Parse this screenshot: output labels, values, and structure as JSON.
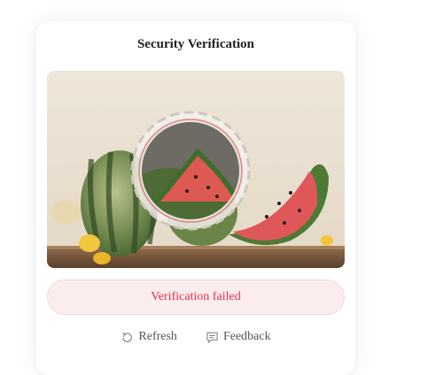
{
  "dialog": {
    "title": "Security Verification",
    "status_message": "Verification failed"
  },
  "captcha": {
    "image_subject": "watermelon",
    "rotate_piece": "circular-rotate-piece"
  },
  "actions": {
    "refresh_label": "Refresh",
    "feedback_label": "Feedback"
  },
  "colors": {
    "status_text": "#e0314a",
    "status_bg": "#fbecee",
    "title_text": "#222222",
    "action_text": "#555555"
  },
  "icons": {
    "refresh": "refresh-icon",
    "feedback": "feedback-icon"
  }
}
